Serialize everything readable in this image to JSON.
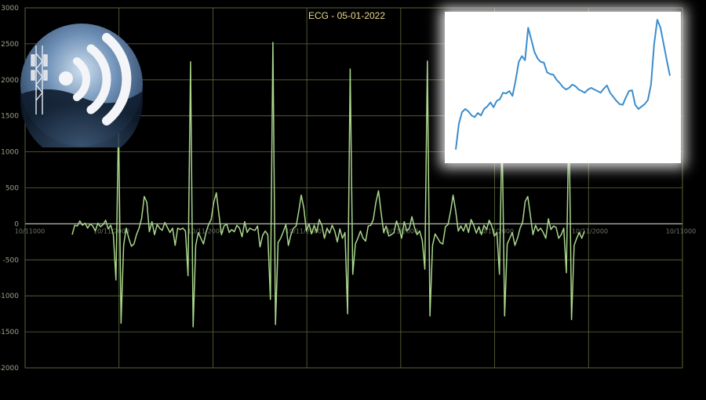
{
  "chart_data": [
    {
      "type": "line",
      "title": "ECG - 05-01-2022",
      "xlabel": "",
      "ylabel": "",
      "ylim": [
        -2000,
        3000
      ],
      "yticks": [
        3000,
        2500,
        2000,
        1500,
        1000,
        500,
        0,
        -500,
        -1000,
        -1500,
        -2000
      ],
      "x_tick_labels": [
        "10/11000",
        "10/11/2000",
        "10/11/2000",
        "10/11/2000",
        "10/11/2000",
        "10/11/2000",
        "10/11/2000",
        "10/11000"
      ],
      "grid": true,
      "color": "#a9d68c",
      "series": [
        {
          "values": [
            -150,
            -20,
            -30,
            40,
            -20,
            10,
            -60,
            0,
            -30,
            -100,
            10,
            -40,
            -10,
            50,
            -70,
            -20,
            -150,
            -780,
            1400,
            -1380,
            -300,
            -60,
            -200,
            -310,
            -280,
            -150,
            -60,
            80,
            380,
            300,
            -110,
            30,
            -150,
            -10,
            -60,
            -90,
            20,
            -50,
            -120,
            -60,
            -300,
            -60,
            -80,
            -60,
            -100,
            -720,
            2250,
            -1430,
            -300,
            -120,
            -200,
            -280,
            -120,
            -10,
            60,
            300,
            430,
            140,
            -150,
            -30,
            0,
            -120,
            -80,
            -110,
            -20,
            -60,
            -180,
            30,
            -120,
            -60,
            -80,
            -90,
            -30,
            -320,
            -160,
            -100,
            -150,
            -1050,
            2520,
            -1400,
            -260,
            -200,
            -110,
            -10,
            -300,
            -150,
            -60,
            -30,
            170,
            400,
            220,
            -100,
            0,
            -140,
            -20,
            -120,
            60,
            -20,
            -200,
            -60,
            -130,
            -20,
            -100,
            -250,
            -70,
            -200,
            -120,
            -1250,
            2150,
            -700,
            -280,
            -200,
            -100,
            -200,
            -240,
            -30,
            -20,
            60,
            300,
            460,
            160,
            -120,
            -30,
            -170,
            -150,
            -120,
            40,
            -60,
            -200,
            30,
            -100,
            -60,
            100,
            -50,
            -150,
            -100,
            -230,
            -630,
            2260,
            -1280,
            -300,
            -140,
            -200,
            -260,
            -280,
            -40,
            -10,
            170,
            400,
            180,
            -100,
            -30,
            -100,
            0,
            -120,
            60,
            -20,
            -130,
            -40,
            -150,
            -20,
            -80,
            50,
            -30,
            -170,
            -120,
            -700,
            1300,
            -1280,
            -280,
            -200,
            -120,
            -300,
            -200,
            -60,
            20,
            310,
            380,
            120,
            -150,
            -20,
            -100,
            -60,
            -120,
            -200,
            70,
            -80,
            -30,
            -50,
            -200,
            -150,
            -60,
            -680,
            1500,
            -1330,
            -300,
            -200,
            -120,
            -200,
            -100
          ]
        }
      ]
    },
    {
      "type": "line",
      "title": "",
      "xlabel": "",
      "ylabel": "",
      "axes_visible": false,
      "color": "#3b8dcc",
      "series": [
        {
          "values": [
            10,
            42,
            56,
            60,
            57,
            52,
            50,
            55,
            52,
            60,
            63,
            68,
            62,
            70,
            72,
            80,
            79,
            82,
            76,
            95,
            118,
            125,
            120,
            160,
            145,
            130,
            122,
            118,
            117,
            105,
            103,
            102,
            96,
            92,
            87,
            84,
            86,
            90,
            88,
            84,
            82,
            80,
            84,
            86,
            84,
            82,
            80,
            85,
            89,
            80,
            75,
            70,
            66,
            65,
            74,
            82,
            83,
            65,
            60,
            63,
            66,
            71,
            90,
            140,
            170,
            160,
            140,
            120,
            101
          ]
        }
      ]
    }
  ],
  "decor": {
    "tower_logo": "cell-tower-wifi-logo"
  }
}
